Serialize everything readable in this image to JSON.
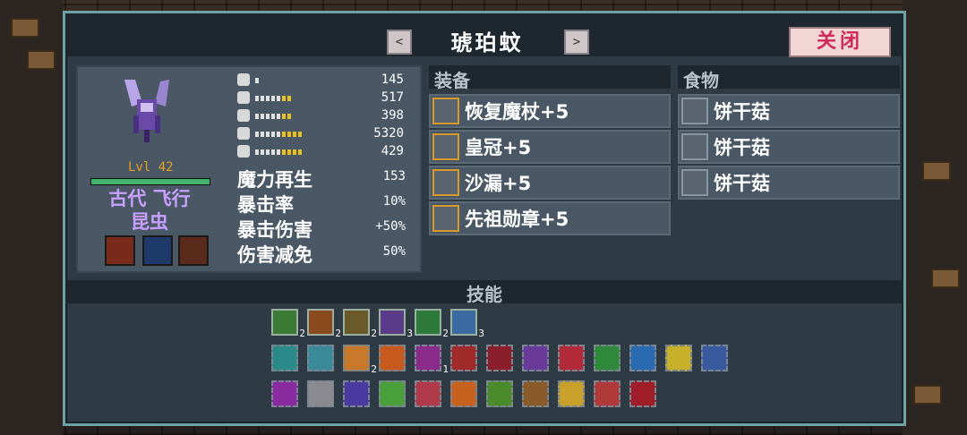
{
  "title": "琥珀蚊",
  "nav": {
    "prev_label": "<",
    "next_label": ">"
  },
  "close_label": "关闭",
  "creature": {
    "level": "Lvl 42",
    "hp_fraction": 1.0,
    "name_line1": "古代 飞行",
    "name_line2": "昆虫",
    "colors": {
      "accent": "#6fa3a3",
      "name": "#c9a0ff",
      "level": "#e8a020"
    }
  },
  "stats": [
    {
      "icon": "sword-icon",
      "value": "145",
      "pips": 1
    },
    {
      "icon": "wand-icon",
      "value": "517",
      "pips": 7
    },
    {
      "icon": "shield-icon",
      "value": "398",
      "pips": 7
    },
    {
      "icon": "heart-icon",
      "value": "5320",
      "pips": 9
    },
    {
      "icon": "mushroom-icon",
      "value": "429",
      "pips": 9
    }
  ],
  "substats": [
    {
      "label": "魔力再生",
      "value": "153"
    },
    {
      "label": "暴击率",
      "value": "10%"
    },
    {
      "label": "暴击伤害",
      "value": "+50%"
    },
    {
      "label": "伤害减免",
      "value": "50%"
    }
  ],
  "equipment": {
    "title": "装备",
    "items": [
      {
        "icon": "staff-icon",
        "label": "恢复魔杖+5"
      },
      {
        "icon": "crown-icon",
        "label": "皇冠+5"
      },
      {
        "icon": "hourglass-icon",
        "label": "沙漏+5"
      },
      {
        "icon": "medal-icon",
        "label": "先祖勋章+5"
      }
    ]
  },
  "food": {
    "title": "食物",
    "items": [
      {
        "icon": "mushroom-icon",
        "label": "饼干菇"
      },
      {
        "icon": "mushroom-icon",
        "label": "饼干菇"
      },
      {
        "icon": "mushroom-icon",
        "label": "饼干菇"
      }
    ]
  },
  "skills": {
    "title": "技能",
    "row1": [
      {
        "icon": "green-orb-icon",
        "count": "2",
        "color": "#3a7a34"
      },
      {
        "icon": "club-icon",
        "count": "2",
        "color": "#8a4a1e"
      },
      {
        "icon": "claw-icon",
        "count": "2",
        "color": "#6a5a2a"
      },
      {
        "icon": "purple-horn-icon",
        "count": "3",
        "color": "#5a3c8a"
      },
      {
        "icon": "green-wave-icon",
        "count": "2",
        "color": "#2e7a3a"
      },
      {
        "icon": "chain-icon",
        "count": "3",
        "color": "#3a6aa0"
      }
    ],
    "row2": [
      {
        "icon": "totem-icon",
        "count": "",
        "color": "#2a8a8a"
      },
      {
        "icon": "potion-icon",
        "count": "",
        "color": "#3a8a9a"
      },
      {
        "icon": "bubbles-icon",
        "count": "2",
        "color": "#c87a2a"
      },
      {
        "icon": "fire-icon",
        "count": "",
        "color": "#c85a1e"
      },
      {
        "icon": "magnify-icon",
        "count": "1",
        "color": "#8a2a8a"
      },
      {
        "icon": "eye-icon",
        "count": "",
        "color": "#a02a2a"
      },
      {
        "icon": "skull-icon",
        "count": "",
        "color": "#8a1e2a"
      },
      {
        "icon": "notes-icon",
        "count": "",
        "color": "#6a3a9a"
      },
      {
        "icon": "burst-icon",
        "count": "",
        "color": "#b02a3a"
      },
      {
        "icon": "heart-plant-icon",
        "count": "",
        "color": "#2e8a3a"
      },
      {
        "icon": "ice-icon",
        "count": "",
        "color": "#2a6ab0"
      },
      {
        "icon": "bulb-icon",
        "count": "",
        "color": "#c8b02a"
      },
      {
        "icon": "spear-icon",
        "count": "",
        "color": "#3a5aa0"
      }
    ],
    "row3": [
      {
        "icon": "drop-icon",
        "count": "",
        "color": "#8a2aa0"
      },
      {
        "icon": "stone-icon",
        "count": "",
        "color": "#8a8a90"
      },
      {
        "icon": "spiral-icon",
        "count": "",
        "color": "#4a3aa0"
      },
      {
        "icon": "vine-icon",
        "count": "",
        "color": "#4aa03a"
      },
      {
        "icon": "brain-icon",
        "count": "",
        "color": "#b03a4a"
      },
      {
        "icon": "flame-ring-icon",
        "count": "",
        "color": "#c8601e"
      },
      {
        "icon": "rope-icon",
        "count": "",
        "color": "#4a8a2a"
      },
      {
        "icon": "antler-icon",
        "count": "",
        "color": "#8a5a2a"
      },
      {
        "icon": "sun-icon",
        "count": "",
        "color": "#c8a02a"
      },
      {
        "icon": "house-icon",
        "count": "",
        "color": "#b03a3a"
      },
      {
        "icon": "demon-icon",
        "count": "",
        "color": "#a01e2a"
      }
    ]
  }
}
